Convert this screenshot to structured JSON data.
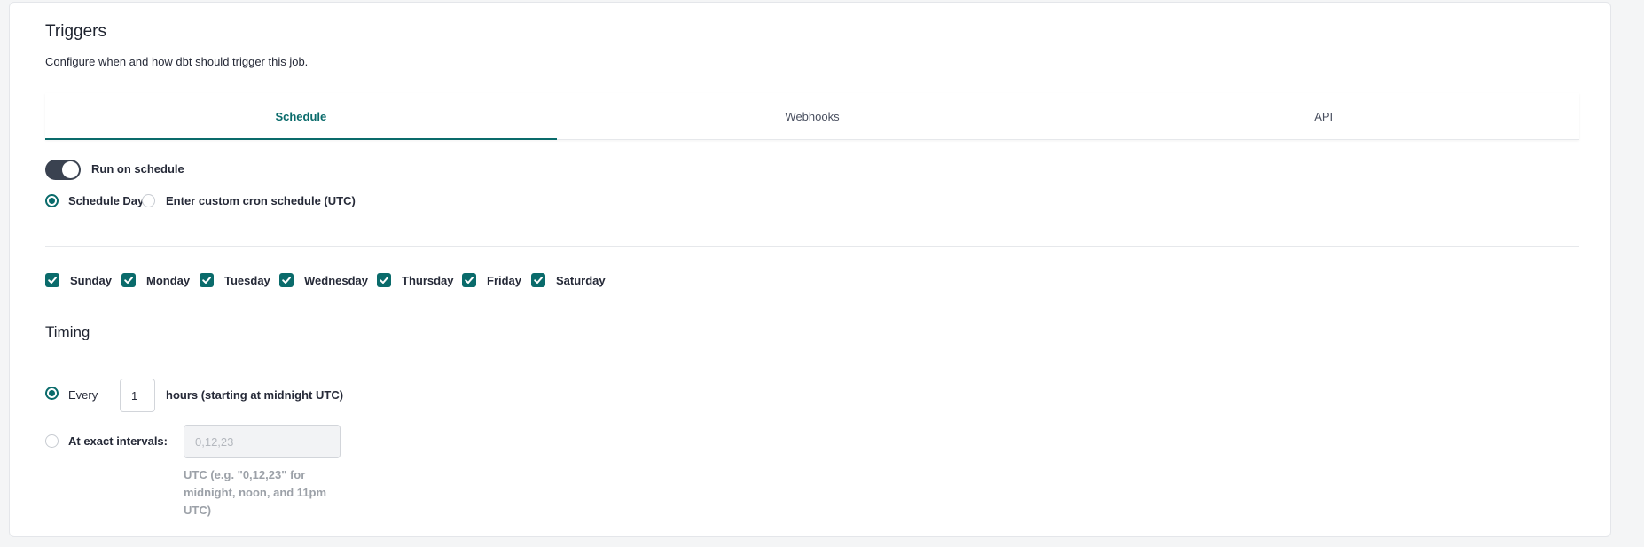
{
  "section": {
    "title": "Triggers",
    "subtitle": "Configure when and how dbt should trigger this job."
  },
  "tabs": [
    {
      "label": "Schedule",
      "active": true
    },
    {
      "label": "Webhooks",
      "active": false
    },
    {
      "label": "API",
      "active": false
    }
  ],
  "run_on_schedule": {
    "label": "Run on schedule",
    "enabled": true
  },
  "schedule_mode": {
    "days_label": "Schedule Days",
    "custom_label": "Enter custom cron schedule (UTC)",
    "selected": "days"
  },
  "days": [
    {
      "label": "Sunday",
      "checked": true
    },
    {
      "label": "Monday",
      "checked": true
    },
    {
      "label": "Tuesday",
      "checked": true
    },
    {
      "label": "Wednesday",
      "checked": true
    },
    {
      "label": "Thursday",
      "checked": true
    },
    {
      "label": "Friday",
      "checked": true
    },
    {
      "label": "Saturday",
      "checked": true
    }
  ],
  "timing": {
    "heading": "Timing",
    "every_label": "Every",
    "every_value": "1",
    "every_suffix": "hours (starting at midnight UTC)",
    "exact_label": "At exact intervals:",
    "exact_placeholder": "0,12,23",
    "exact_value": "",
    "exact_help": "UTC (e.g. \"0,12,23\" for midnight, noon, and 11pm UTC)",
    "selected": "every"
  },
  "colors": {
    "accent": "#0a6b6b",
    "toggle_on": "#3a4250"
  },
  "icons": {
    "checkbox": "check-icon"
  }
}
